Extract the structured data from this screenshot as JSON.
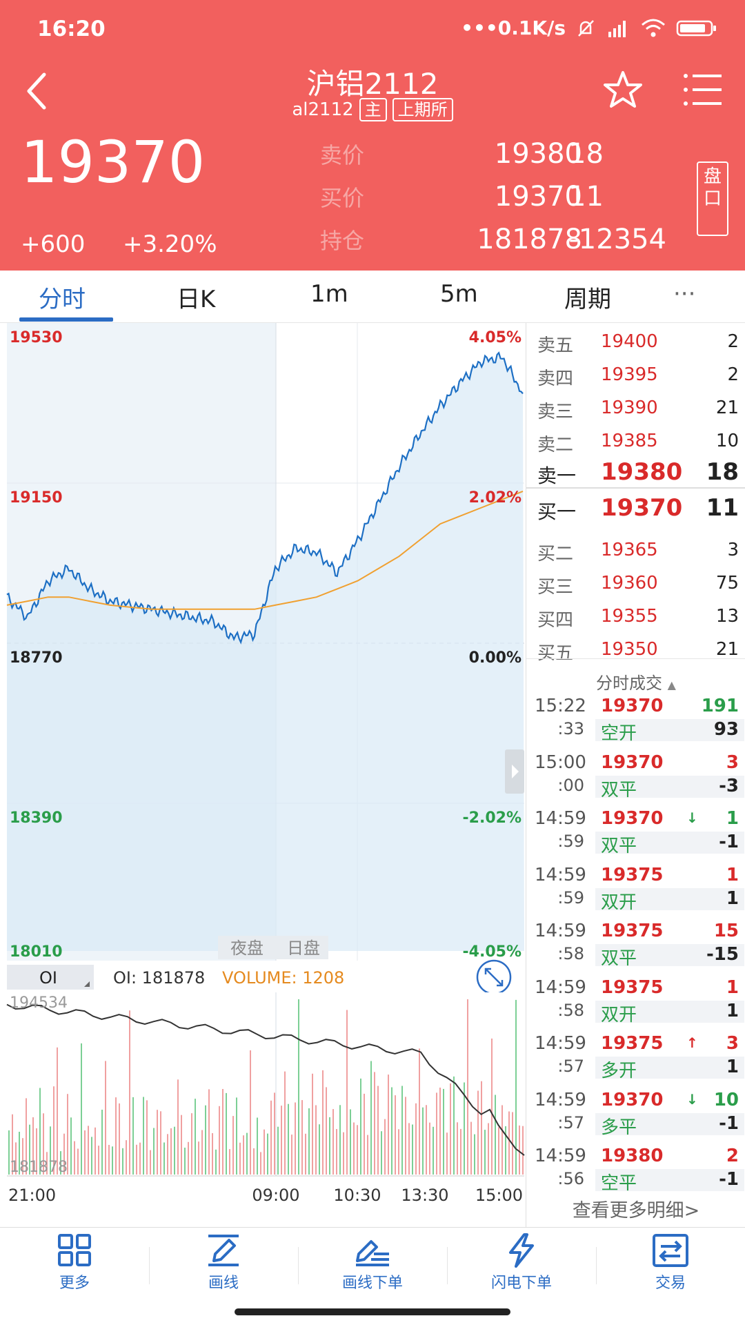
{
  "status": {
    "time": "16:20",
    "net": "•••0.1K/s"
  },
  "header": {
    "title": "沪铝2112",
    "code": "al2112",
    "tag_main": "主",
    "tag_exchange": "上期所",
    "price": "19370",
    "change": "+600",
    "change_pct": "+3.20%",
    "ask_label": "卖价",
    "ask_price": "19380",
    "ask_vol": "18",
    "bid_label": "买价",
    "bid_price": "19370",
    "bid_vol": "11",
    "oi_label": "持仓",
    "oi": "181878",
    "oi_change": "-12354",
    "pankou": "盘口"
  },
  "tabs": [
    {
      "label": "分时",
      "active": true
    },
    {
      "label": "日K"
    },
    {
      "label": "1m"
    },
    {
      "label": "5m"
    },
    {
      "label": "周期"
    },
    {
      "label": "···"
    }
  ],
  "chart": {
    "y_left": [
      "19530",
      "19150",
      "18770",
      "18390",
      "18010"
    ],
    "y_right": [
      "4.05%",
      "2.02%",
      "0.00%",
      "-2.02%",
      "-4.05%"
    ],
    "session_night": "夜盘",
    "session_day": "日盘",
    "x_labels": [
      "21:00",
      "09:00",
      "10:30",
      "13:30",
      "15:00"
    ],
    "sub_select": "OI",
    "sub_oi_text": "OI: 181878",
    "sub_volume_text": "VOLUME: 1208",
    "sub_top_value": "194534",
    "sub_bottom_value": "181878",
    "colors": {
      "price_line": "#1d6fc4",
      "avg_line": "#f0a030",
      "up": "#d92a2a",
      "down": "#2a9d4a",
      "accent": "#2b6cc4"
    }
  },
  "chart_data": {
    "type": "line",
    "x_ticks": [
      "21:00",
      "09:00",
      "10:30",
      "13:30",
      "15:00"
    ],
    "ylim": [
      18010,
      19530
    ],
    "prev_settle": 18770,
    "series": [
      {
        "values": [
          18880,
          18830,
          18920,
          18950,
          18900,
          18870,
          18860,
          18850,
          18840,
          18830,
          18820,
          18780,
          18790,
          18950,
          19000,
          18990,
          18940,
          19020,
          19110,
          19200,
          19280,
          19350,
          19410,
          19460,
          19470,
          19380
        ]
      },
      {
        "values": [
          18860,
          18870,
          18880,
          18880,
          18870,
          18860,
          18855,
          18850,
          18850,
          18850,
          18850,
          18850,
          18850,
          18860,
          18870,
          18880,
          18900,
          18920,
          18950,
          18980,
          19020,
          19060,
          19080,
          19100,
          19120,
          19140
        ]
      }
    ]
  },
  "orderbook": {
    "asks": [
      {
        "label": "卖五",
        "price": "19400",
        "vol": "2"
      },
      {
        "label": "卖四",
        "price": "19395",
        "vol": "2"
      },
      {
        "label": "卖三",
        "price": "19390",
        "vol": "21"
      },
      {
        "label": "卖二",
        "price": "19385",
        "vol": "10"
      },
      {
        "label": "卖一",
        "price": "19380",
        "vol": "18"
      }
    ],
    "bids": [
      {
        "label": "买一",
        "price": "19370",
        "vol": "11"
      },
      {
        "label": "买二",
        "price": "19365",
        "vol": "3"
      },
      {
        "label": "买三",
        "price": "19360",
        "vol": "75"
      },
      {
        "label": "买四",
        "price": "19355",
        "vol": "13"
      },
      {
        "label": "买五",
        "price": "19350",
        "vol": "21"
      }
    ]
  },
  "ticks_title": "分时成交",
  "ticks": [
    {
      "time": "15:22",
      "sec": ":33",
      "price": "19370",
      "arrow": "",
      "vol": "191",
      "type": "空开",
      "oi": "93"
    },
    {
      "time": "15:00",
      "sec": ":00",
      "price": "19370",
      "arrow": "",
      "vol": "3",
      "type": "双平",
      "oi": "-3"
    },
    {
      "time": "14:59",
      "sec": ":59",
      "price": "19370",
      "arrow": "↓",
      "vol": "1",
      "type": "双平",
      "oi": "-1"
    },
    {
      "time": "14:59",
      "sec": ":59",
      "price": "19375",
      "arrow": "",
      "vol": "1",
      "type": "双开",
      "oi": "1"
    },
    {
      "time": "14:59",
      "sec": ":58",
      "price": "19375",
      "arrow": "",
      "vol": "15",
      "type": "双平",
      "oi": "-15"
    },
    {
      "time": "14:59",
      "sec": ":58",
      "price": "19375",
      "arrow": "",
      "vol": "1",
      "type": "双开",
      "oi": "1"
    },
    {
      "time": "14:59",
      "sec": ":57",
      "price": "19375",
      "arrow": "↑",
      "vol": "3",
      "type": "多开",
      "oi": "1"
    },
    {
      "time": "14:59",
      "sec": ":57",
      "price": "19370",
      "arrow": "↓",
      "vol": "10",
      "type": "多平",
      "oi": "-1"
    },
    {
      "time": "14:59",
      "sec": ":56",
      "price": "19380",
      "arrow": "",
      "vol": "2",
      "type": "空平",
      "oi": "-1"
    }
  ],
  "more_details": "查看更多明细>",
  "toolbar": [
    {
      "label": "更多",
      "icon": "grid-icon"
    },
    {
      "label": "画线",
      "icon": "pencil-icon"
    },
    {
      "label": "画线下单",
      "icon": "pen-order-icon"
    },
    {
      "label": "闪电下单",
      "icon": "lightning-icon"
    },
    {
      "label": "交易",
      "icon": "exchange-icon"
    }
  ]
}
